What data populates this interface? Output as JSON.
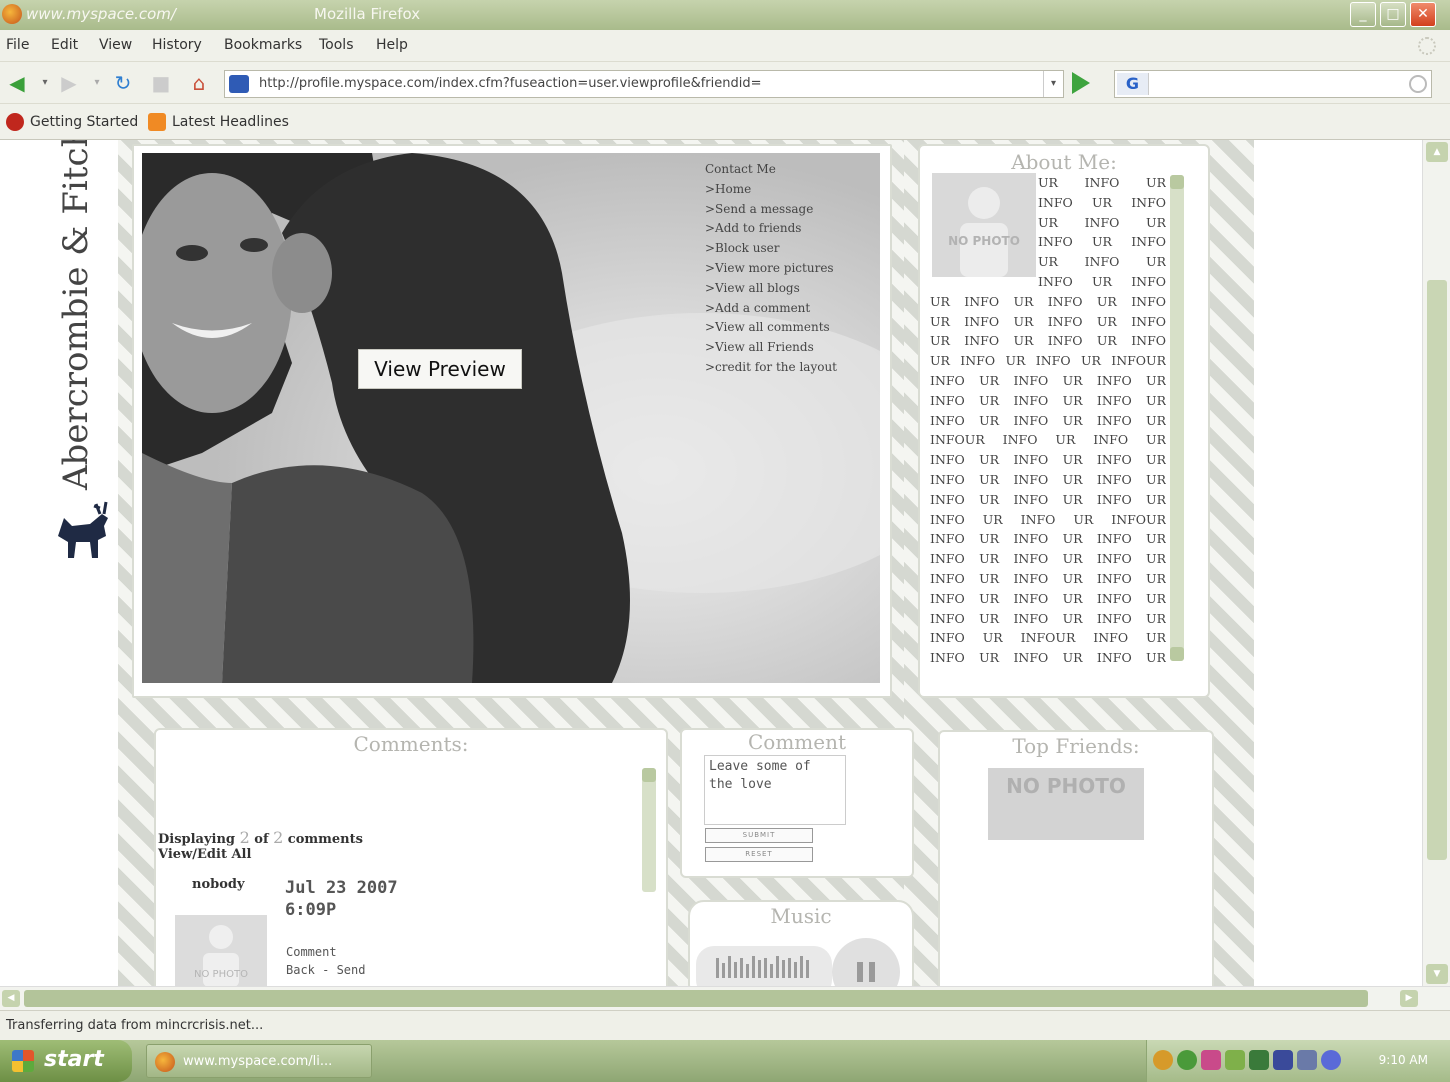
{
  "window": {
    "url_title": "www.myspace.com/",
    "app_title": "Mozilla Firefox"
  },
  "menu": [
    "File",
    "Edit",
    "View",
    "History",
    "Bookmarks",
    "Tools",
    "Help"
  ],
  "address_bar": {
    "url": "http://profile.myspace.com/index.cfm?fuseaction=user.viewprofile&friendid="
  },
  "search": {
    "engine_icon": "G"
  },
  "bookmarks": [
    "Getting Started",
    "Latest Headlines"
  ],
  "page": {
    "brand": "Abercrombie & Fitch",
    "contact": {
      "title": "Contact Me",
      "links": [
        ">Home",
        ">Send a message",
        ">Add to friends",
        ">Block user",
        ">View more pictures",
        ">View all blogs",
        ">Add a comment",
        ">View all comments",
        ">View all Friends",
        ">credit for the layout"
      ]
    },
    "view_preview": "View Preview",
    "about": {
      "title": "About Me:",
      "photo_label": "NO PHOTO",
      "text": "UR INFO UR INFO UR INFO UR INFO UR INFO UR INFO UR INFO UR INFO UR INFO UR INFO UR INFO UR INFO UR INFO UR INFO UR INFO UR INFO UR INFO UR INFO UR INFO UR INFO UR INFOUR INFO UR INFO UR INFO UR INFO UR INFO UR INFO UR INFO UR INFO UR INFO UR INFOUR INFO UR INFO UR INFO UR INFO UR INFO UR INFO UR INFO UR INFO UR INFO UR INFO UR INFO UR INFO UR INFO UR INFOUR INFO UR INFO UR INFO UR INFO UR INFO UR INFO UR INFO UR INFO UR INFO UR INFO UR INFO UR INFO UR INFO UR INFO UR INFO UR INFO UR INFOUR INFO UR INFO UR INFO UR INFO UR INFO UR INFO UR INFOUR INFO UR INFO UR INFO UR INFO UR INFO UR INFO UR INFO UR INFO UR INFO UR INFO UR INFO UR INFO UR INFO UR INFO UR INFO UR INFO UR INFO UR INFO UR INFO UR INFO UR INFOUR INFO UR INFO UR INFO"
    },
    "comments": {
      "title": "Comments:",
      "displaying": "Displaying",
      "shown": "2",
      "of": "of",
      "total": "2",
      "comments_word": "comments",
      "view_edit": "View/Edit All",
      "author": "nobody",
      "date": "Jul 23 2007",
      "time": "6:09P",
      "photo_label": "NO PHOTO",
      "comment_label": "Comment",
      "back_send": "Back - Send"
    },
    "comment_form": {
      "title": "Comment",
      "textarea": "Leave some of the love",
      "submit": "SUBMIT",
      "reset": "RESET"
    },
    "music": {
      "title": "Music"
    },
    "top_friends": {
      "title": "Top Friends:",
      "photo_label": "NO PHOTO"
    }
  },
  "status_bar": "Transferring data from mincrcrisis.net...",
  "taskbar": {
    "start": "start",
    "task": "www.myspace.com/li...",
    "clock": "9:10 AM"
  }
}
